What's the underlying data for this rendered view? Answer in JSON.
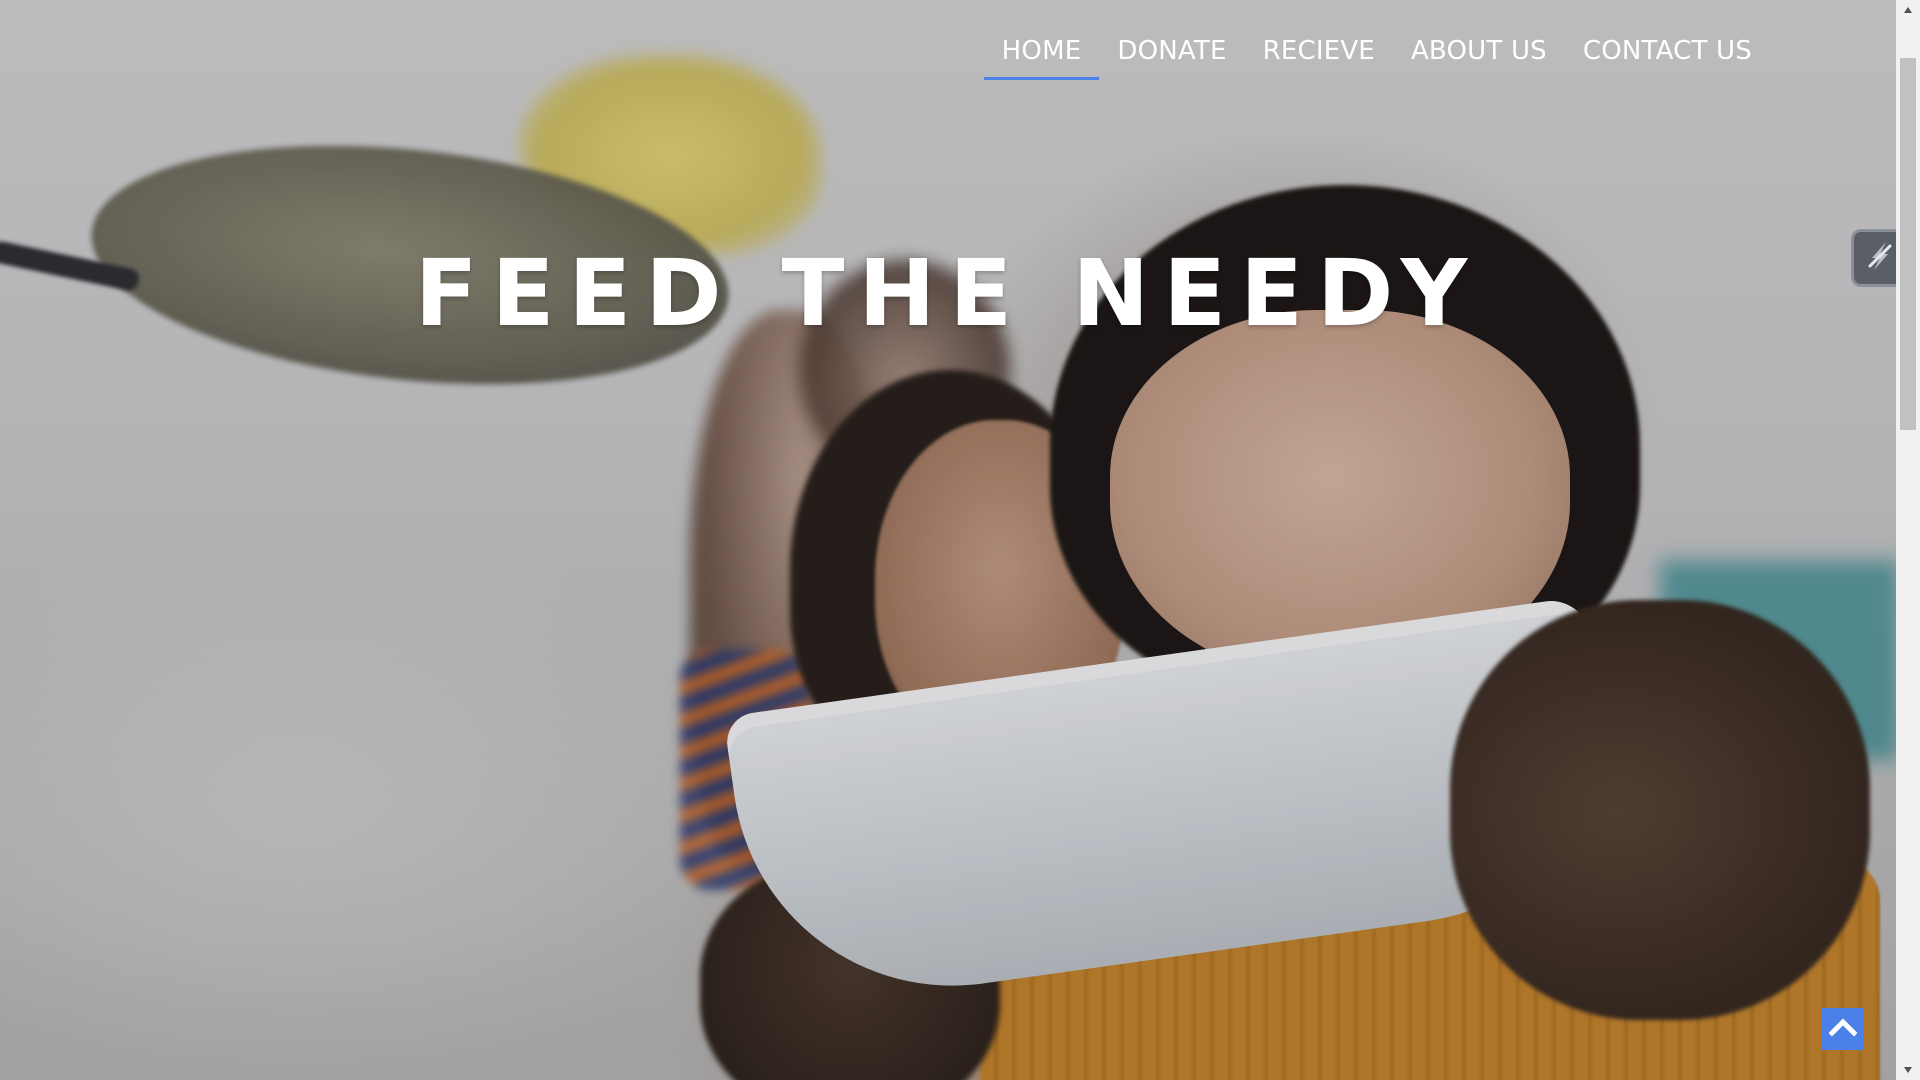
{
  "nav": {
    "items": [
      {
        "label": "HOME",
        "active": true
      },
      {
        "label": "DONATE",
        "active": false
      },
      {
        "label": "RECIEVE",
        "active": false
      },
      {
        "label": "ABOUT US",
        "active": false
      },
      {
        "label": "CONTACT US",
        "active": false
      }
    ],
    "active_underline_color": "#4a80e8"
  },
  "hero": {
    "title": "FEED THE NEEDY",
    "image_subject": "children holding bowls waiting for food"
  },
  "widgets": {
    "side_widget_icon": "slash-logo-icon",
    "back_to_top_icon": "chevron-up-icon",
    "back_to_top_color": "#4a80e8"
  },
  "scrollbar": {
    "up_icon": "triangle-up-icon",
    "down_icon": "triangle-down-icon"
  }
}
